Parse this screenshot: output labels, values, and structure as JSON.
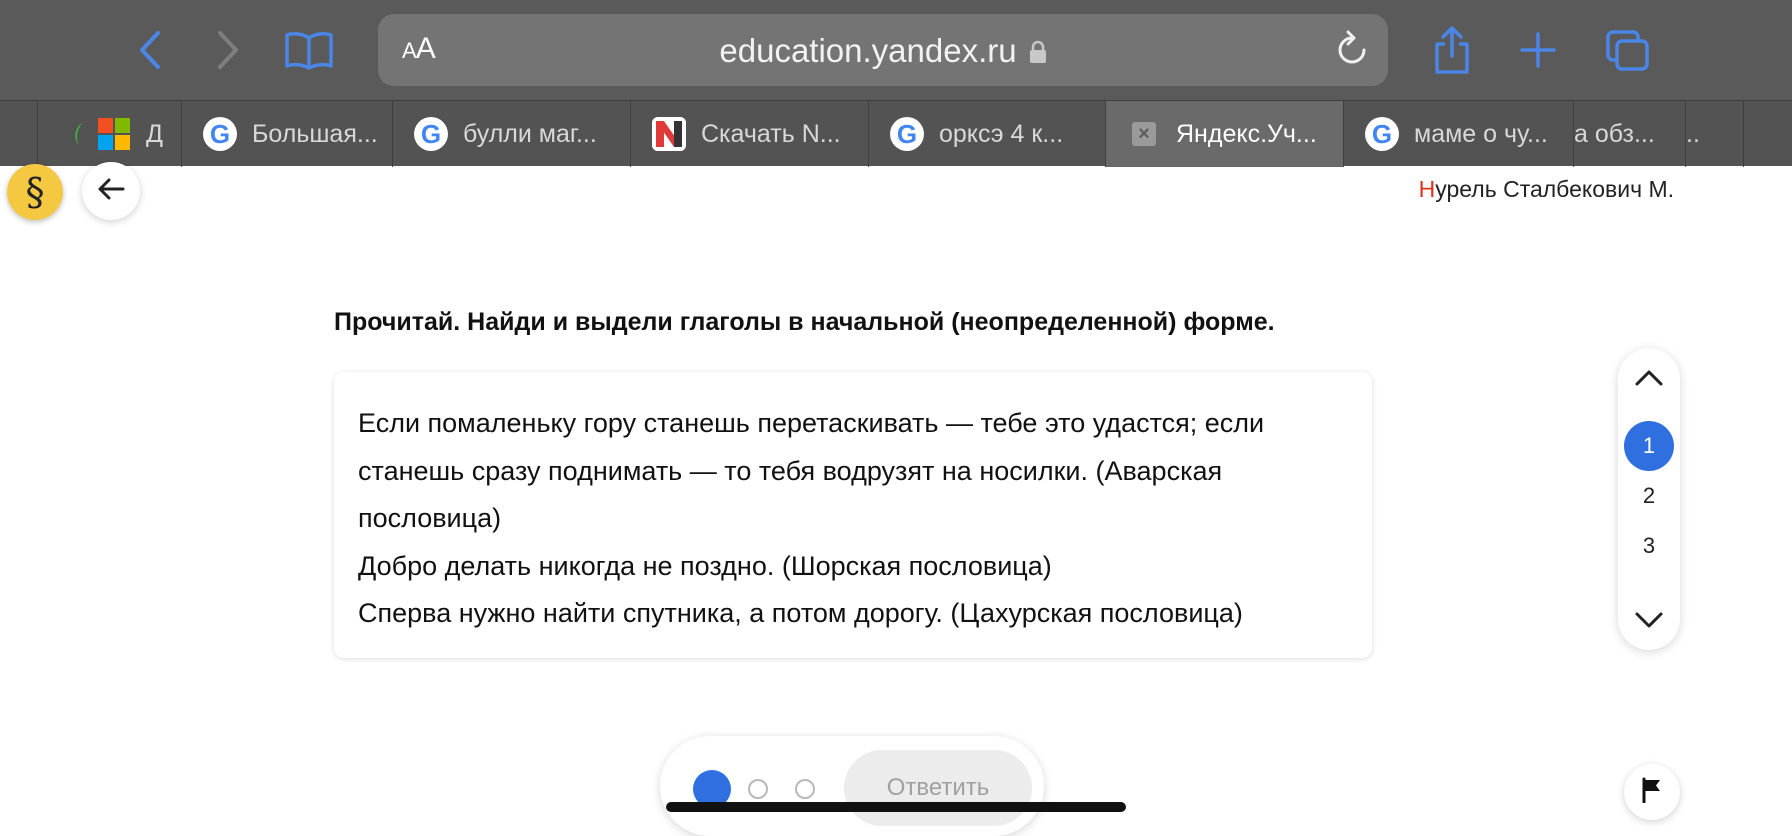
{
  "browser": {
    "text_size_label_small": "A",
    "text_size_label_large": "A",
    "url": "education.yandex.ru",
    "icons": {
      "back": "chevron-left-icon",
      "forward": "chevron-right-icon",
      "bookmarks": "book-icon",
      "lock": "lock-icon",
      "reload": "reload-icon",
      "share": "share-icon",
      "new_tab": "plus-icon",
      "tabs_overview": "tabs-icon"
    },
    "accent_color": "#4a86e8"
  },
  "tabs": [
    {
      "label": "Д",
      "favicon": "microsoft-icon",
      "active": false
    },
    {
      "label": "Большая...",
      "favicon": "google-icon",
      "active": false
    },
    {
      "label": "булли маг...",
      "favicon": "google-icon",
      "active": false
    },
    {
      "label": "Скачать N...",
      "favicon": "n-icon",
      "active": false
    },
    {
      "label": "орксэ 4 к...",
      "favicon": "google-icon",
      "active": false
    },
    {
      "label": "Яндекс.Уч...",
      "favicon": "close-icon",
      "active": true
    },
    {
      "label": "маме о чу...",
      "favicon": "google-icon",
      "active": false
    },
    {
      "label": "а обз...",
      "favicon": "",
      "active": false
    },
    {
      "label": "..",
      "favicon": "",
      "active": false
    }
  ],
  "page": {
    "user_initial": "Н",
    "user_name_rest": "урель Сталбекович М.",
    "task_title": "Прочитай. Найди и выдели глаголы в начальной (неопределенной) форме.",
    "paragraphs": [
      "Если помаленьку гору станешь перетаскивать — тебе это удастся; если станешь сразу поднимать — то тебя водрузят на носилки. (Аварская пословица)",
      "Добро делать никогда не поздно. (Шорская пословица)",
      "Сперва нужно найти спутника, а потом дорогу. (Цахурская пословица)"
    ],
    "task_numbers": [
      "1",
      "2",
      "3"
    ],
    "active_task": "1",
    "answer_label": "Ответить",
    "accent_color": "#2f6fe0",
    "user_initial_color": "#e0301e"
  }
}
